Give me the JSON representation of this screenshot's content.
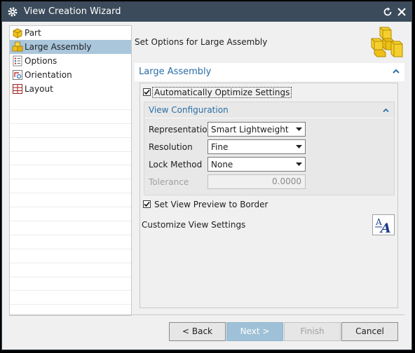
{
  "window": {
    "title": "View Creation Wizard"
  },
  "nav": {
    "items": [
      {
        "label": "Part",
        "icon": "part-icon",
        "selected": false
      },
      {
        "label": "Large Assembly",
        "icon": "large-assembly-icon",
        "selected": true
      },
      {
        "label": "Options",
        "icon": "options-icon",
        "selected": false
      },
      {
        "label": "Orientation",
        "icon": "orientation-icon",
        "selected": false
      },
      {
        "label": "Layout",
        "icon": "layout-icon",
        "selected": false
      }
    ]
  },
  "header": {
    "text": "Set Options for Large Assembly",
    "image_icon": "large-assembly-cubes-icon"
  },
  "section": {
    "title": "Large Assembly",
    "auto_optimize": {
      "label": "Automatically Optimize Settings",
      "checked": true
    },
    "view_configuration": {
      "title": "View Configuration",
      "representation": {
        "label": "Representation",
        "value": "Smart Lightweight"
      },
      "resolution": {
        "label": "Resolution",
        "value": "Fine"
      },
      "lock_method": {
        "label": "Lock Method",
        "value": "None"
      },
      "tolerance": {
        "label": "Tolerance",
        "value": "0.0000"
      }
    },
    "preview_border": {
      "label": "Set View Preview to Border",
      "checked": true
    },
    "customize": {
      "label": "Customize View Settings",
      "icon": "text-style-icon"
    }
  },
  "footer": {
    "back": "< Back",
    "next": "Next >",
    "finish": "Finish",
    "cancel": "Cancel"
  },
  "colors": {
    "titlebar": "#3b4b5b",
    "selection": "#a9c6db",
    "section_title": "#2a6ea6",
    "primary_button": "#9fc1d8"
  }
}
